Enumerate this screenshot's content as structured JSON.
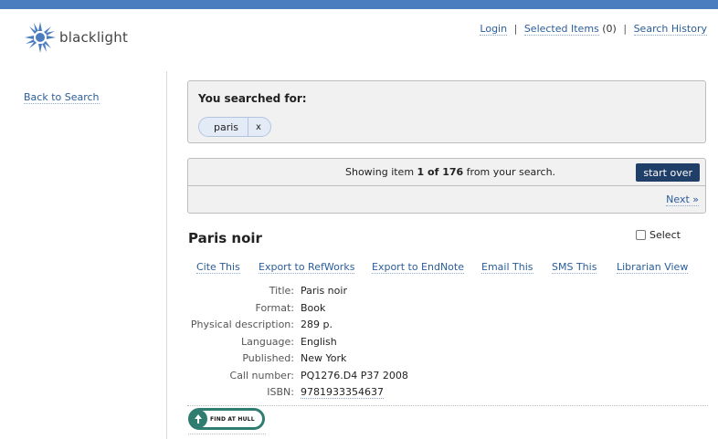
{
  "brand": {
    "name": "blacklight",
    "accent": "#4a7cc0",
    "logo_color": "#4a7cc0"
  },
  "util_nav": {
    "login": "Login",
    "selected_items": "Selected Items",
    "selected_count": "(0)",
    "search_history": "Search History",
    "separator": "|"
  },
  "sidebar": {
    "back_to_search": "Back to Search"
  },
  "constraints": {
    "heading": "You searched for:",
    "query": "paris",
    "remove": "x"
  },
  "pager": {
    "prefix": "Showing item",
    "position": "1 of 176",
    "suffix": "from your search.",
    "start_over": "start over",
    "next": "Next »",
    "button_color": "#1f3e68"
  },
  "document": {
    "title": "Paris noir",
    "select_label": "Select",
    "tools": [
      "Cite This",
      "Export to RefWorks",
      "Export to EndNote",
      "Email This",
      "SMS This",
      "Librarian View"
    ],
    "fields": [
      {
        "label": "Title:",
        "value": "Paris noir"
      },
      {
        "label": "Format:",
        "value": "Book"
      },
      {
        "label": "Physical description:",
        "value": "289 p."
      },
      {
        "label": "Language:",
        "value": "English"
      },
      {
        "label": "Published:",
        "value": "New York"
      },
      {
        "label": "Call number:",
        "value": "PQ1276.D4 P37 2008"
      },
      {
        "label": "ISBN:",
        "value": "9781933354637"
      }
    ],
    "find_badge": "FIND AT HULL",
    "badge_color": "#2f7c71"
  }
}
